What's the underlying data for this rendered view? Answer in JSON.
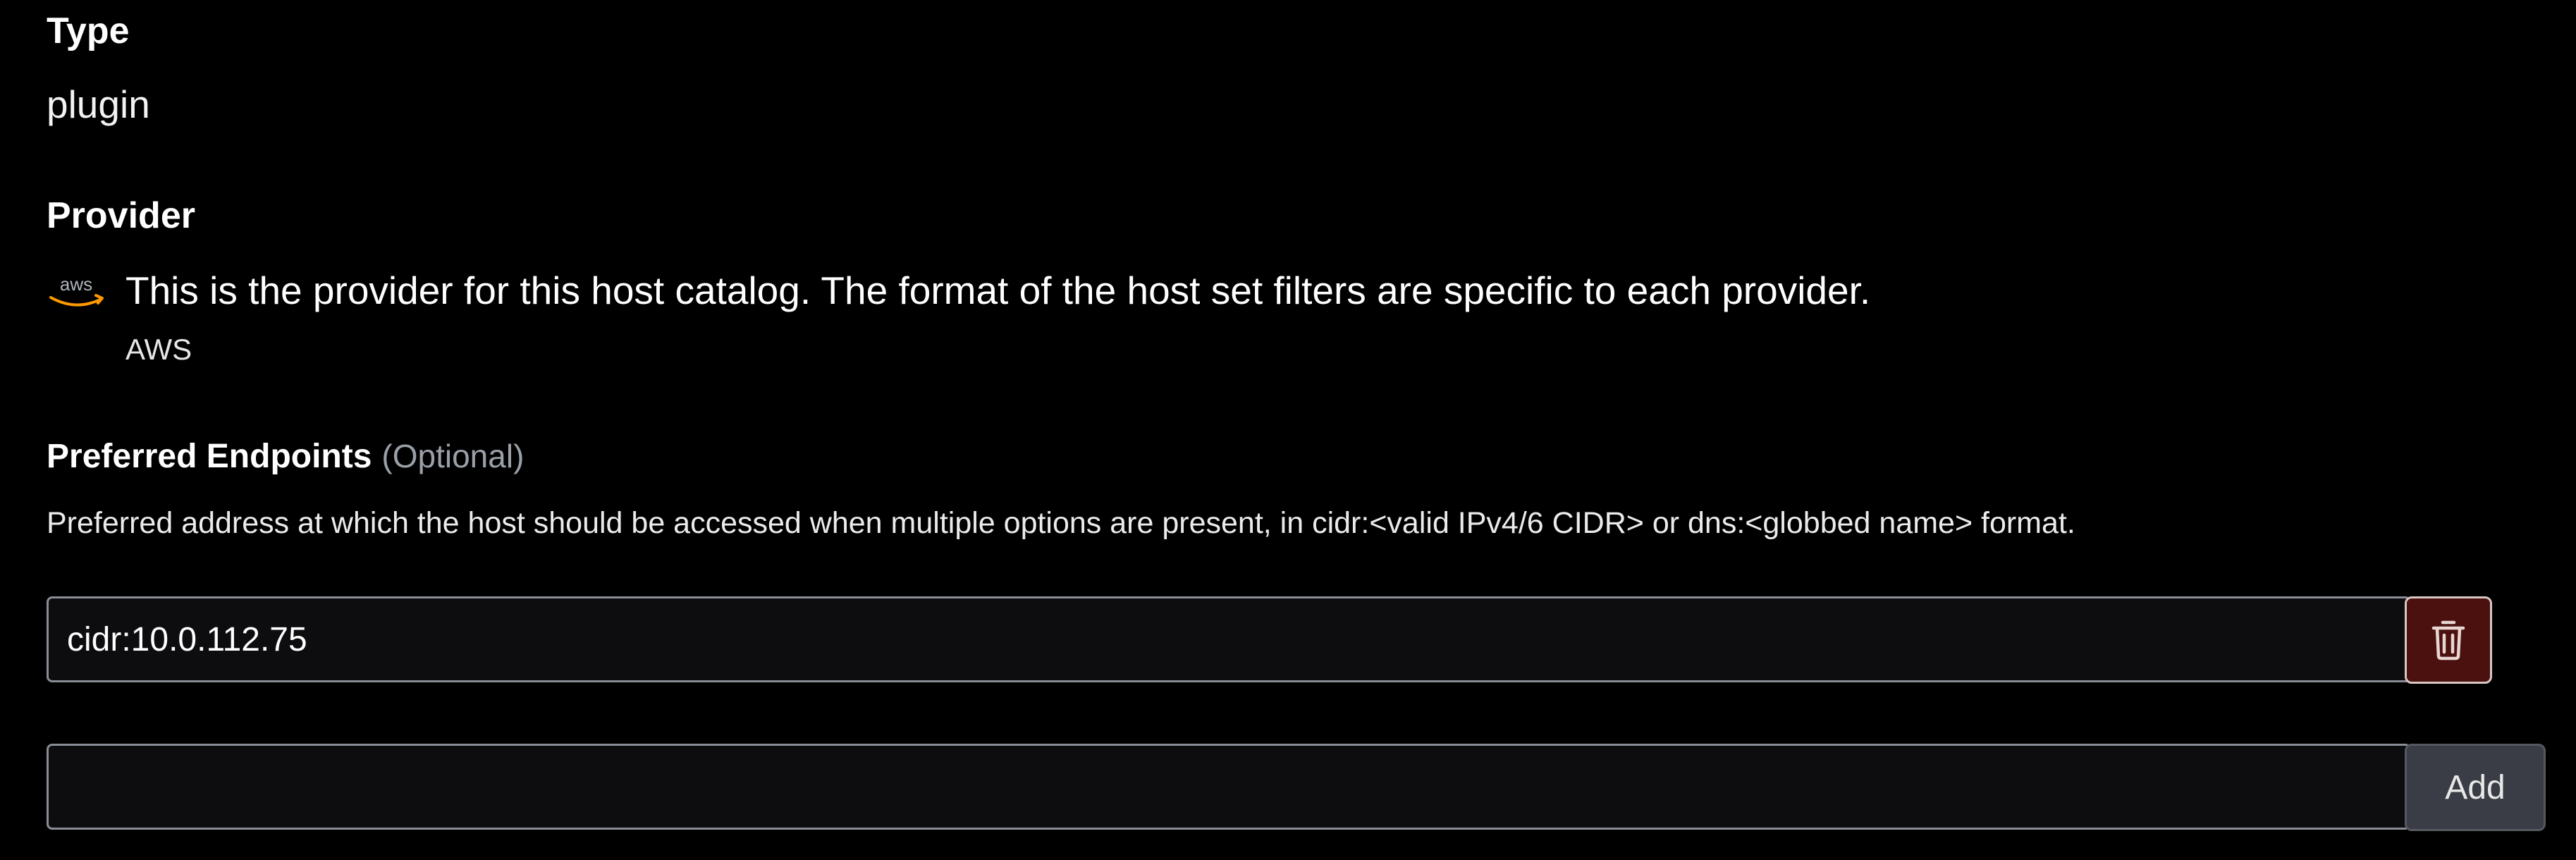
{
  "type_field": {
    "label": "Type",
    "value": "plugin"
  },
  "provider_field": {
    "label": "Provider",
    "icon": "aws-logo-icon",
    "logo_text": "aws",
    "description": "This is the provider for this host catalog. The format of the host set filters are specific to each provider.",
    "name": "AWS"
  },
  "preferred_endpoints": {
    "label": "Preferred Endpoints",
    "optional": "(Optional)",
    "help": "Preferred address at which the host should be accessed when multiple options are present, in cidr:<valid IPv4/6 CIDR> or dns:<globbed name> format.",
    "entries": [
      {
        "value": "cidr:10.0.112.75"
      }
    ],
    "new_entry": {
      "value": "",
      "placeholder": ""
    },
    "delete_icon": "trash-icon",
    "add_label": "Add"
  },
  "colors": {
    "background": "#000000",
    "delete_button_bg": "#4a110e",
    "add_button_bg": "#3a3d45",
    "aws_orange": "#ff9900",
    "muted_text": "#9aa0a8"
  }
}
